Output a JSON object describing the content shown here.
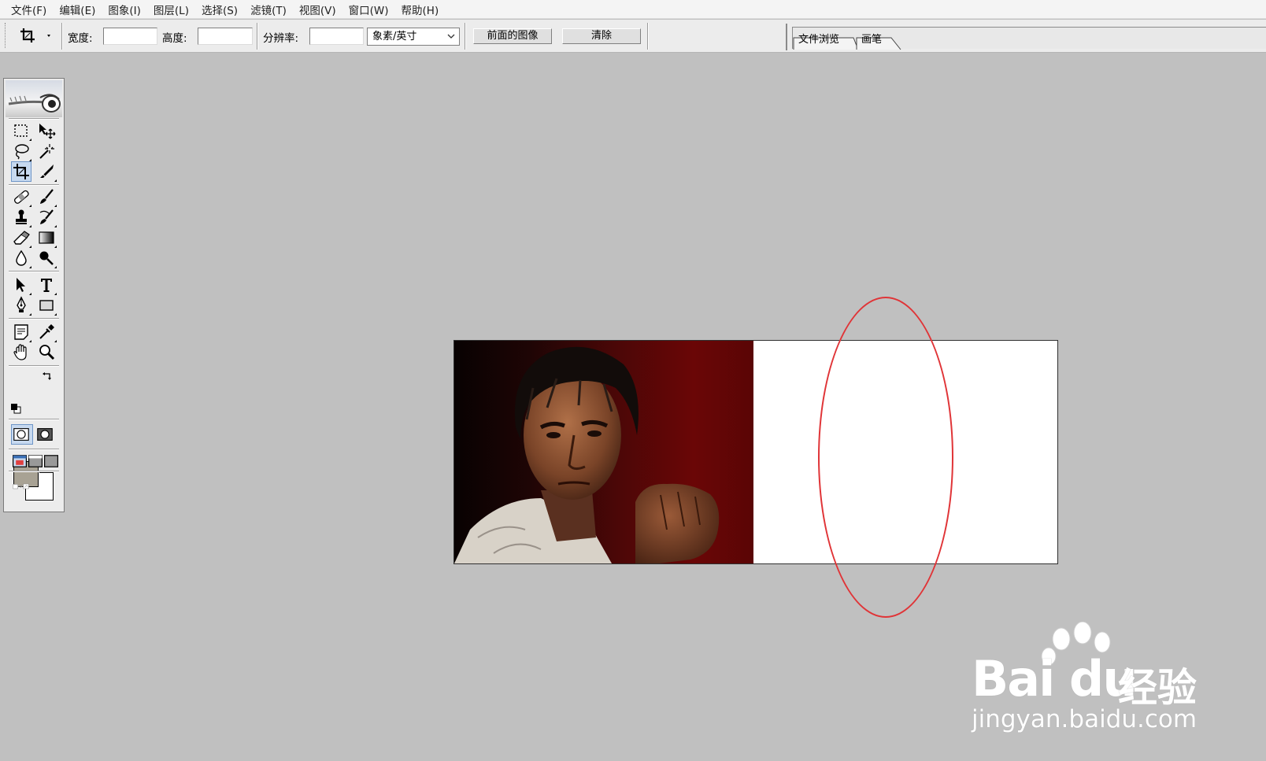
{
  "menu": [
    "文件(F)",
    "编辑(E)",
    "图象(I)",
    "图层(L)",
    "选择(S)",
    "滤镜(T)",
    "视图(V)",
    "窗口(W)",
    "帮助(H)"
  ],
  "options": {
    "width_label": "宽度:",
    "width_value": "",
    "height_label": "高度:",
    "height_value": "",
    "resolution_label": "分辨率:",
    "resolution_value": "",
    "unit_selected": "象素/英寸",
    "front_image_button": "前面的图像",
    "clear_button": "清除"
  },
  "palette_well": {
    "tabs": [
      "文件浏览",
      "画笔"
    ]
  },
  "toolbox": {
    "active_tool": "crop-tool",
    "tools": [
      "rectangular-marquee",
      "move",
      "lasso",
      "magic-wand",
      "crop",
      "slice",
      "healing-brush",
      "brush",
      "clone-stamp",
      "history-brush",
      "eraser",
      "gradient",
      "blur",
      "dodge",
      "path-selection",
      "type",
      "pen",
      "rectangle-shape",
      "notes",
      "eyedropper",
      "hand",
      "zoom"
    ],
    "foreground_color": "#a8a294",
    "background_color": "#ffffff"
  },
  "canvas": {
    "photo_subject": "portrait of a man with raised fist against dark red background",
    "annotation_color": "#e03437"
  },
  "watermark": {
    "logo": "Bai du",
    "brand_cn": "经验",
    "url": "jingyan.baidu.com"
  }
}
